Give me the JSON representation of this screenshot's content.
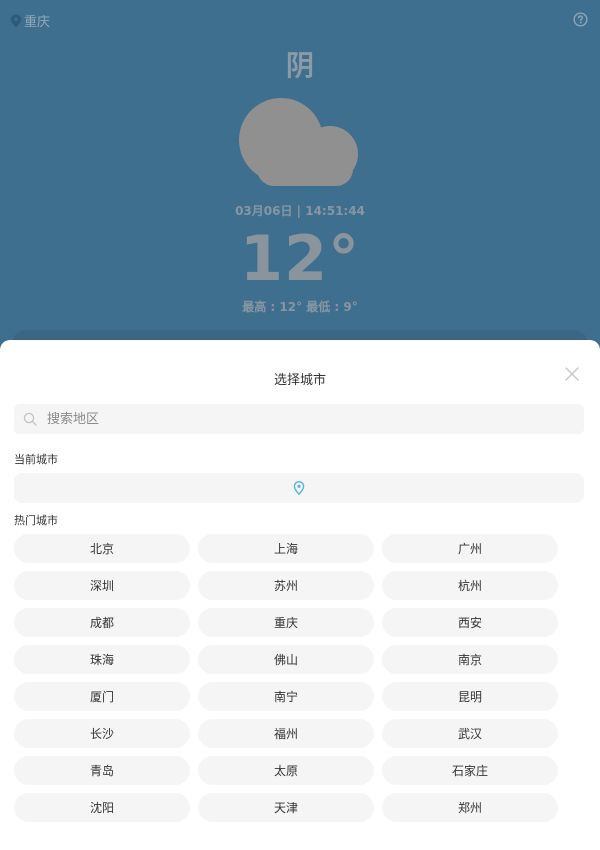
{
  "header": {
    "city": "重庆",
    "location_icon": "location-pin-icon",
    "help_icon": "question-circle-icon"
  },
  "weather": {
    "condition": "阴",
    "icon": "cloudy-icon",
    "datetime": "03月06日 | 14:51:44",
    "temperature": "12°",
    "high_low": "最高 : 12° 最低 : 9°"
  },
  "sheet": {
    "title": "选择城市",
    "close_icon": "close-icon",
    "search_placeholder": "搜索地区",
    "current_label": "当前城市",
    "current_icon": "location-pin-icon",
    "hot_label": "热门城市",
    "hot_cities": [
      "北京",
      "上海",
      "广州",
      "深圳",
      "苏州",
      "杭州",
      "成都",
      "重庆",
      "西安",
      "珠海",
      "佛山",
      "南京",
      "厦门",
      "南宁",
      "昆明",
      "长沙",
      "福州",
      "武汉",
      "青岛",
      "太原",
      "石家庄",
      "沈阳",
      "天津",
      "郑州"
    ]
  },
  "colors": {
    "background": "#3f6f8e",
    "accent": "#4fb4e8",
    "chip_bg": "#f5f5f5"
  }
}
